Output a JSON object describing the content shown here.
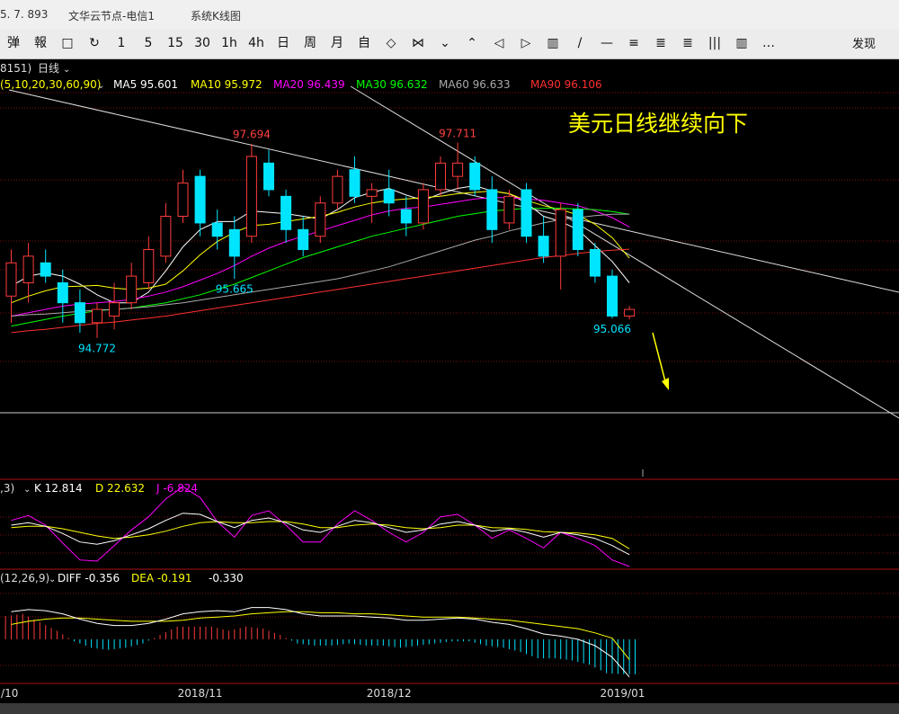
{
  "window": {
    "tabs": [
      {
        "label": "5. 7. 893"
      },
      {
        "label": "文华云节点-电信1"
      },
      {
        "label": "系统K线图"
      }
    ]
  },
  "toolbar": {
    "tools": [
      "弹",
      "報",
      "□",
      "↻",
      "1",
      "5",
      "15",
      "30",
      "1h",
      "4h",
      "日",
      "周",
      "月",
      "自",
      "◇",
      "⋈",
      "⌄",
      "⌃",
      "◁",
      "▷",
      "▥",
      "/",
      "—",
      "≡",
      "≣",
      "≣",
      "|||",
      "▥",
      "…"
    ],
    "discover_label": "发现"
  },
  "chart_data": {
    "type": "candlestick",
    "symbol_code": "8151)",
    "period_label": "日线",
    "title": "美元日线继续向下",
    "ma_params": "(5,10,20,30,60,90)",
    "ma_legend": [
      {
        "name": "MA5",
        "value": "95.601",
        "color": "#ffffff"
      },
      {
        "name": "MA10",
        "value": "95.972",
        "color": "#ffff00"
      },
      {
        "name": "MA20",
        "value": "96.439",
        "color": "#ff00ff"
      },
      {
        "name": "MA30",
        "value": "96.632",
        "color": "#00ff00"
      },
      {
        "name": "MA60",
        "value": "96.633",
        "color": "#aaaaaa"
      },
      {
        "name": "MA90",
        "value": "96.106",
        "color": "#ff3030"
      }
    ],
    "price_annotations": [
      {
        "label": "97.694",
        "price": 97.694,
        "idx": 14,
        "pos": "above",
        "color": "#ff4040"
      },
      {
        "label": "97.711",
        "price": 97.711,
        "idx": 26,
        "pos": "above",
        "color": "#ff4040"
      },
      {
        "label": "95.665",
        "price": 95.665,
        "idx": 13,
        "pos": "below",
        "color": "#00e5ff"
      },
      {
        "label": "94.772",
        "price": 94.772,
        "idx": 5,
        "pos": "below",
        "color": "#00e5ff"
      },
      {
        "label": "95.066",
        "price": 95.066,
        "idx": 35,
        "pos": "below",
        "color": "#00e5ff"
      }
    ],
    "x_labels": [
      {
        "label": "/10",
        "idx": -0.6
      },
      {
        "label": "2018/11",
        "idx": 11
      },
      {
        "label": "2018/12",
        "idx": 22
      },
      {
        "label": "2019/01",
        "idx": 35.6
      }
    ],
    "price_range": [
      93.7,
      98.5
    ],
    "candles": [
      {
        "o": 95.4,
        "h": 96.1,
        "l": 95.0,
        "c": 95.9
      },
      {
        "o": 95.6,
        "h": 96.2,
        "l": 95.3,
        "c": 96.0
      },
      {
        "o": 95.9,
        "h": 96.1,
        "l": 95.6,
        "c": 95.7
      },
      {
        "o": 95.6,
        "h": 95.8,
        "l": 95.0,
        "c": 95.3
      },
      {
        "o": 95.3,
        "h": 95.5,
        "l": 94.85,
        "c": 95.0
      },
      {
        "o": 95.0,
        "h": 95.3,
        "l": 94.77,
        "c": 95.2
      },
      {
        "o": 95.1,
        "h": 95.6,
        "l": 94.9,
        "c": 95.3
      },
      {
        "o": 95.3,
        "h": 95.9,
        "l": 95.2,
        "c": 95.7
      },
      {
        "o": 95.6,
        "h": 96.3,
        "l": 95.5,
        "c": 96.1
      },
      {
        "o": 96.0,
        "h": 96.8,
        "l": 95.9,
        "c": 96.6
      },
      {
        "o": 96.6,
        "h": 97.3,
        "l": 96.5,
        "c": 97.1
      },
      {
        "o": 97.2,
        "h": 97.3,
        "l": 96.3,
        "c": 96.5
      },
      {
        "o": 96.5,
        "h": 96.7,
        "l": 96.1,
        "c": 96.3
      },
      {
        "o": 96.4,
        "h": 96.6,
        "l": 95.66,
        "c": 96.0
      },
      {
        "o": 96.3,
        "h": 97.69,
        "l": 96.2,
        "c": 97.5
      },
      {
        "o": 97.4,
        "h": 97.6,
        "l": 96.9,
        "c": 97.0
      },
      {
        "o": 96.9,
        "h": 97.0,
        "l": 96.2,
        "c": 96.4
      },
      {
        "o": 96.4,
        "h": 96.6,
        "l": 96.0,
        "c": 96.1
      },
      {
        "o": 96.3,
        "h": 96.9,
        "l": 96.2,
        "c": 96.8
      },
      {
        "o": 96.8,
        "h": 97.3,
        "l": 96.7,
        "c": 97.2
      },
      {
        "o": 97.3,
        "h": 97.5,
        "l": 96.8,
        "c": 96.9
      },
      {
        "o": 96.9,
        "h": 97.1,
        "l": 96.5,
        "c": 97.0
      },
      {
        "o": 97.0,
        "h": 97.3,
        "l": 96.6,
        "c": 96.8
      },
      {
        "o": 96.7,
        "h": 96.9,
        "l": 96.3,
        "c": 96.5
      },
      {
        "o": 96.5,
        "h": 97.1,
        "l": 96.4,
        "c": 97.0
      },
      {
        "o": 97.0,
        "h": 97.5,
        "l": 96.9,
        "c": 97.4
      },
      {
        "o": 97.2,
        "h": 97.71,
        "l": 97.0,
        "c": 97.4
      },
      {
        "o": 97.4,
        "h": 97.5,
        "l": 96.9,
        "c": 97.0
      },
      {
        "o": 97.0,
        "h": 97.2,
        "l": 96.2,
        "c": 96.4
      },
      {
        "o": 96.5,
        "h": 97.0,
        "l": 96.4,
        "c": 96.9
      },
      {
        "o": 97.0,
        "h": 97.1,
        "l": 96.2,
        "c": 96.3
      },
      {
        "o": 96.3,
        "h": 96.6,
        "l": 95.9,
        "c": 96.0
      },
      {
        "o": 96.0,
        "h": 96.8,
        "l": 95.5,
        "c": 96.7
      },
      {
        "o": 96.7,
        "h": 96.8,
        "l": 96.0,
        "c": 96.1
      },
      {
        "o": 96.1,
        "h": 96.2,
        "l": 95.6,
        "c": 95.7
      },
      {
        "o": 95.7,
        "h": 95.8,
        "l": 95.066,
        "c": 95.1
      },
      {
        "o": 95.1,
        "h": 95.25,
        "l": 95.05,
        "c": 95.2
      }
    ],
    "ma_lines": [
      {
        "name": "MA5",
        "color": "#ffffff",
        "values": [
          95.55,
          95.7,
          95.75,
          95.7,
          95.58,
          95.42,
          95.3,
          95.3,
          95.46,
          95.78,
          96.14,
          96.4,
          96.52,
          96.52,
          96.68,
          96.66,
          96.64,
          96.6,
          96.56,
          96.7,
          96.88,
          96.96,
          97.02,
          96.92,
          96.84,
          96.94,
          97.02,
          97.06,
          96.98,
          96.94,
          96.8,
          96.6,
          96.52,
          96.4,
          96.16,
          95.92,
          95.6
        ]
      },
      {
        "name": "MA10",
        "color": "#ffff00",
        "values": [
          95.3,
          95.4,
          95.48,
          95.54,
          95.55,
          95.56,
          95.52,
          95.5,
          95.52,
          95.58,
          95.78,
          96.02,
          96.22,
          96.36,
          96.46,
          96.48,
          96.52,
          96.56,
          96.6,
          96.66,
          96.74,
          96.8,
          96.84,
          96.86,
          96.88,
          96.9,
          96.94,
          96.96,
          96.98,
          96.94,
          96.84,
          96.76,
          96.7,
          96.62,
          96.48,
          96.28,
          95.97
        ]
      },
      {
        "name": "MA20",
        "color": "#ff00ff",
        "values": [
          95.1,
          95.15,
          95.2,
          95.25,
          95.28,
          95.3,
          95.32,
          95.35,
          95.4,
          95.46,
          95.54,
          95.64,
          95.74,
          95.86,
          96.0,
          96.12,
          96.22,
          96.3,
          96.38,
          96.46,
          96.54,
          96.62,
          96.68,
          96.72,
          96.74,
          96.78,
          96.82,
          96.86,
          96.88,
          96.88,
          96.86,
          96.84,
          96.8,
          96.76,
          96.68,
          96.58,
          96.44
        ]
      },
      {
        "name": "MA30",
        "color": "#00ff00",
        "values": [
          94.95,
          95.0,
          95.05,
          95.1,
          95.14,
          95.18,
          95.2,
          95.22,
          95.26,
          95.3,
          95.36,
          95.42,
          95.5,
          95.58,
          95.68,
          95.78,
          95.88,
          95.98,
          96.06,
          96.14,
          96.22,
          96.3,
          96.36,
          96.42,
          96.48,
          96.54,
          96.6,
          96.64,
          96.68,
          96.7,
          96.72,
          96.72,
          96.72,
          96.71,
          96.7,
          96.67,
          96.63
        ]
      },
      {
        "name": "MA60",
        "color": "#aaaaaa",
        "values": [
          95.1,
          95.12,
          95.13,
          95.15,
          95.17,
          95.19,
          95.2,
          95.22,
          95.24,
          95.27,
          95.3,
          95.34,
          95.38,
          95.42,
          95.46,
          95.5,
          95.54,
          95.58,
          95.62,
          95.66,
          95.72,
          95.78,
          95.84,
          95.92,
          96.0,
          96.08,
          96.16,
          96.24,
          96.3,
          96.38,
          96.44,
          96.5,
          96.55,
          96.58,
          96.61,
          96.63,
          96.633
        ]
      },
      {
        "name": "MA90",
        "color": "#ff3030",
        "values": [
          94.85,
          94.88,
          94.9,
          94.93,
          94.96,
          94.99,
          95.01,
          95.04,
          95.07,
          95.1,
          95.14,
          95.18,
          95.22,
          95.26,
          95.3,
          95.34,
          95.38,
          95.42,
          95.46,
          95.5,
          95.54,
          95.58,
          95.62,
          95.66,
          95.7,
          95.74,
          95.78,
          95.82,
          95.86,
          95.9,
          95.94,
          95.98,
          96.01,
          96.04,
          96.07,
          96.09,
          96.106
        ]
      }
    ],
    "kdj": {
      "params": ",3)",
      "legend": [
        {
          "name": "K",
          "value": "12.814",
          "color": "#ffffff"
        },
        {
          "name": "D",
          "value": "22.632",
          "color": "#ffff00"
        },
        {
          "name": "J",
          "value": "-6.824",
          "color": "#ff00ff"
        }
      ],
      "range": [
        -10,
        110
      ],
      "K": [
        62,
        66,
        60,
        48,
        34,
        30,
        36,
        46,
        56,
        70,
        82,
        80,
        68,
        58,
        70,
        74,
        66,
        54,
        50,
        60,
        70,
        66,
        58,
        50,
        54,
        64,
        68,
        62,
        52,
        56,
        50,
        42,
        50,
        46,
        40,
        28,
        12.8
      ],
      "D": [
        58,
        60,
        60,
        56,
        50,
        44,
        40,
        42,
        46,
        52,
        60,
        66,
        68,
        66,
        66,
        68,
        68,
        64,
        58,
        58,
        62,
        64,
        62,
        58,
        56,
        58,
        62,
        62,
        58,
        57,
        55,
        51,
        50,
        49,
        46,
        40,
        22.6
      ],
      "J": [
        70,
        78,
        62,
        32,
        4,
        2,
        28,
        54,
        76,
        106,
        126,
        108,
        68,
        42,
        78,
        86,
        62,
        34,
        34,
        64,
        86,
        70,
        50,
        34,
        50,
        76,
        80,
        62,
        40,
        54,
        40,
        24,
        50,
        40,
        28,
        4,
        -6.8
      ]
    },
    "macd": {
      "params": "(12,26,9)",
      "legend": [
        {
          "name": "DIFF",
          "value": "-0.356",
          "color": "#ffffff"
        },
        {
          "name": "DEA",
          "value": "-0.191",
          "color": "#ffff00"
        },
        {
          "name": "MACD",
          "value": "-0.330",
          "color": "#ffffff"
        }
      ],
      "range": [
        -0.4,
        0.5
      ],
      "DIFF": [
        0.26,
        0.28,
        0.27,
        0.24,
        0.19,
        0.15,
        0.13,
        0.13,
        0.15,
        0.19,
        0.24,
        0.26,
        0.27,
        0.26,
        0.3,
        0.3,
        0.28,
        0.24,
        0.22,
        0.22,
        0.22,
        0.21,
        0.2,
        0.18,
        0.18,
        0.19,
        0.2,
        0.19,
        0.16,
        0.14,
        0.1,
        0.05,
        0.03,
        0.0,
        -0.06,
        -0.17,
        -0.356
      ],
      "DEA": [
        0.14,
        0.17,
        0.19,
        0.2,
        0.2,
        0.19,
        0.18,
        0.17,
        0.17,
        0.17,
        0.18,
        0.2,
        0.21,
        0.22,
        0.24,
        0.25,
        0.26,
        0.26,
        0.25,
        0.25,
        0.24,
        0.24,
        0.23,
        0.22,
        0.21,
        0.21,
        0.21,
        0.2,
        0.19,
        0.18,
        0.16,
        0.14,
        0.12,
        0.1,
        0.06,
        0.01,
        -0.191
      ],
      "bars": [
        0.22,
        0.24,
        0.16,
        0.08,
        -0.02,
        -0.08,
        -0.1,
        -0.08,
        -0.04,
        0.04,
        0.12,
        0.12,
        0.12,
        0.08,
        0.12,
        0.1,
        0.04,
        -0.04,
        -0.06,
        -0.06,
        -0.04,
        -0.06,
        -0.06,
        -0.08,
        -0.06,
        -0.04,
        -0.02,
        -0.02,
        -0.06,
        -0.08,
        -0.12,
        -0.18,
        -0.18,
        -0.2,
        -0.24,
        -0.32,
        -0.33
      ]
    }
  }
}
